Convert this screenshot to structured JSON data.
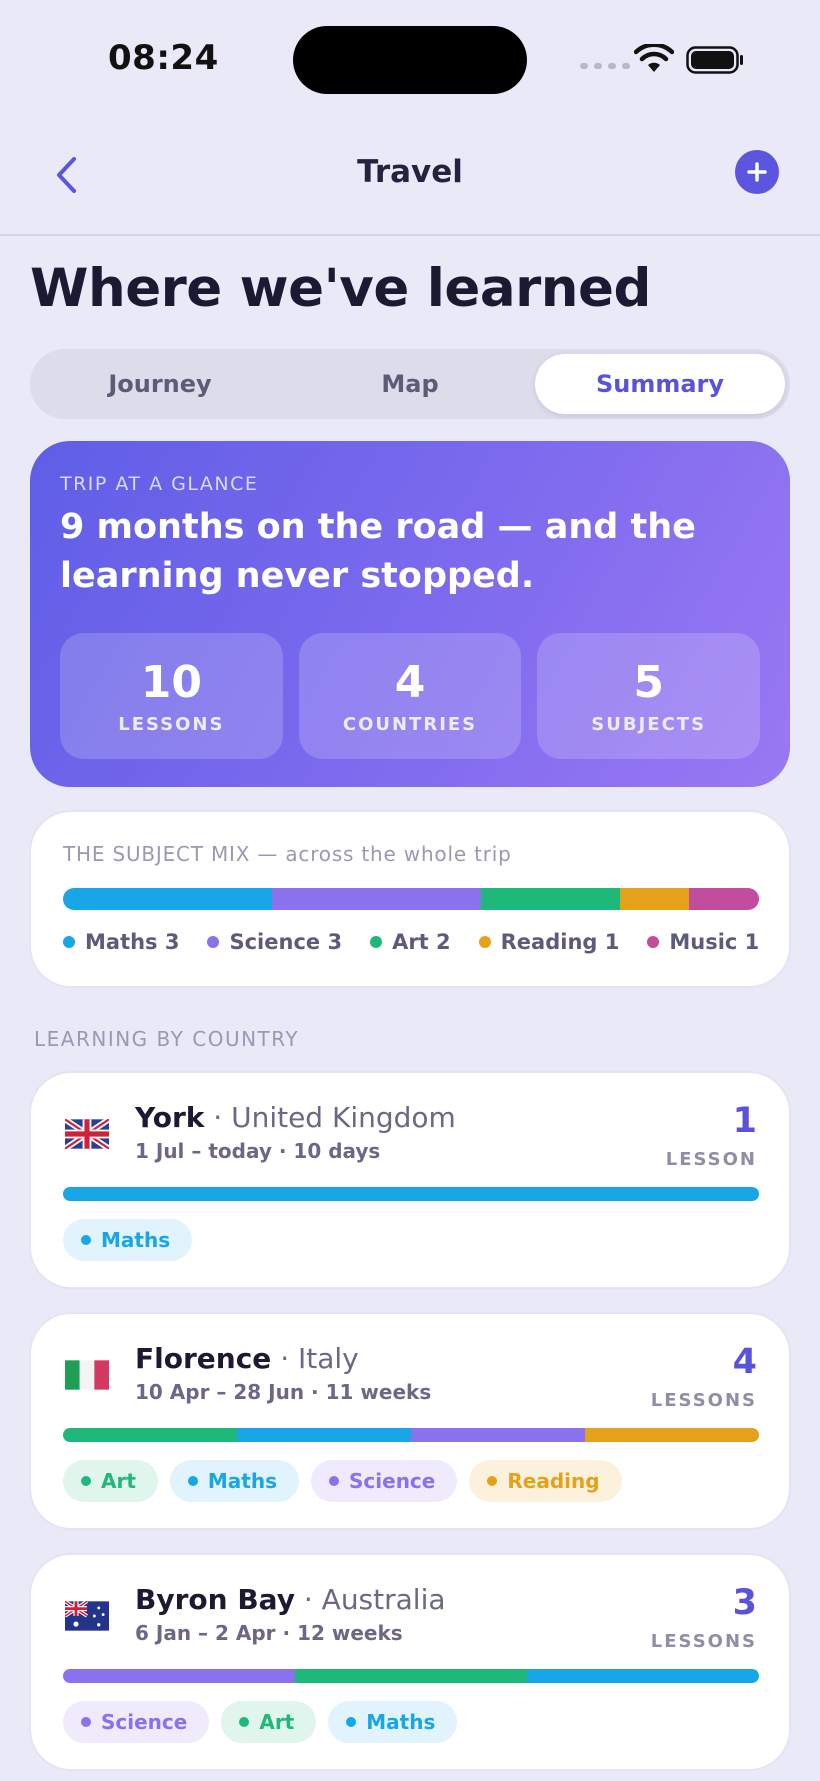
{
  "status": {
    "time": "08:24"
  },
  "nav": {
    "title": "Travel"
  },
  "page": {
    "title": "Where we've learned"
  },
  "tabs": [
    {
      "label": "Journey",
      "active": false
    },
    {
      "label": "Map",
      "active": false
    },
    {
      "label": "Summary",
      "active": true
    }
  ],
  "hero": {
    "eyebrow": "TRIP AT A GLANCE",
    "headline": "9 months on the road — and the learning never stopped.",
    "stats": [
      {
        "value": "10",
        "label": "LESSONS"
      },
      {
        "value": "4",
        "label": "COUNTRIES"
      },
      {
        "value": "5",
        "label": "SUBJECTS"
      }
    ]
  },
  "colors": {
    "accent": "#5b52dc",
    "maths": "#18a6e6",
    "science": "#8a72ee",
    "art": "#1fb87b",
    "reading": "#e3a21a",
    "music": "#c24d9c"
  },
  "subject_mix": {
    "title": "THE SUBJECT MIX — across the whole trip",
    "subjects": [
      {
        "name": "Maths",
        "count": 3,
        "label": "Maths 3",
        "color": "#18a6e6"
      },
      {
        "name": "Science",
        "count": 3,
        "label": "Science 3",
        "color": "#8a72ee"
      },
      {
        "name": "Art",
        "count": 2,
        "label": "Art 2",
        "color": "#1fb87b"
      },
      {
        "name": "Reading",
        "count": 1,
        "label": "Reading 1",
        "color": "#e3a21a"
      },
      {
        "name": "Music",
        "count": 1,
        "label": "Music 1",
        "color": "#c24d9c"
      }
    ]
  },
  "countries_section": {
    "label": "LEARNING BY COUNTRY"
  },
  "countries": [
    {
      "city": "York",
      "country": "· United Kingdom",
      "dates": "1 Jul – today · 10 days",
      "count": "1",
      "count_label": "LESSON",
      "flag": "uk-flag",
      "bar": [
        "#18a6e6"
      ],
      "chips": [
        {
          "label": "Maths",
          "color": "#18a6e6",
          "bg": "#e1f3fc"
        }
      ]
    },
    {
      "city": "Florence",
      "country": "· Italy",
      "dates": "10 Apr – 28 Jun · 11 weeks",
      "count": "4",
      "count_label": "LESSONS",
      "flag": "italy-flag",
      "bar": [
        "#1fb87b",
        "#18a6e6",
        "#8a72ee",
        "#e3a21a"
      ],
      "chips": [
        {
          "label": "Art",
          "color": "#1fb87b",
          "bg": "#e0f5ec"
        },
        {
          "label": "Maths",
          "color": "#18a6e6",
          "bg": "#e1f3fc"
        },
        {
          "label": "Science",
          "color": "#8a72ee",
          "bg": "#efeafc"
        },
        {
          "label": "Reading",
          "color": "#e3a21a",
          "bg": "#fcf1dc"
        }
      ]
    },
    {
      "city": "Byron Bay",
      "country": "· Australia",
      "dates": "6 Jan – 2 Apr · 12 weeks",
      "count": "3",
      "count_label": "LESSONS",
      "flag": "australia-flag",
      "bar": [
        "#8a72ee",
        "#1fb87b",
        "#18a6e6"
      ],
      "chips": [
        {
          "label": "Science",
          "color": "#8a72ee",
          "bg": "#efeafc"
        },
        {
          "label": "Art",
          "color": "#1fb87b",
          "bg": "#e0f5ec"
        },
        {
          "label": "Maths",
          "color": "#18a6e6",
          "bg": "#e1f3fc"
        }
      ]
    }
  ]
}
